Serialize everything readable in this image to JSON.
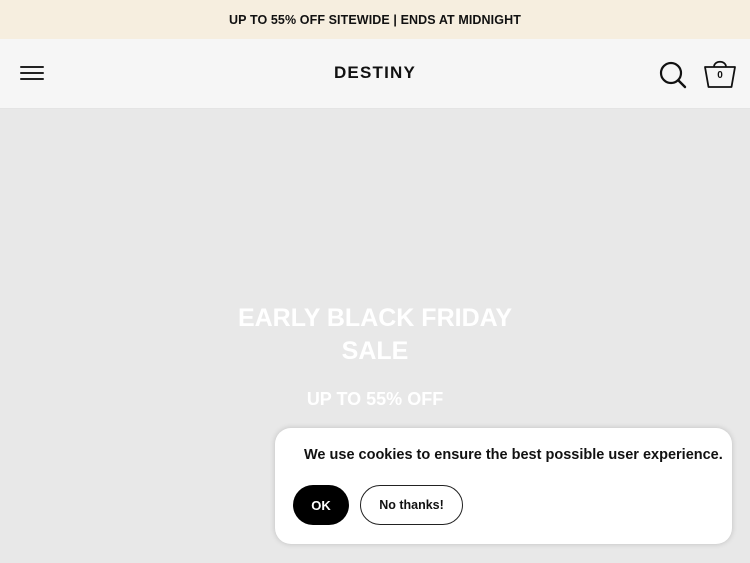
{
  "announcement": {
    "text": "UP TO 55% OFF SITEWIDE | ENDS AT MIDNIGHT"
  },
  "header": {
    "logo": "DESTINY",
    "menu_icon": "hamburger-menu-icon",
    "search_icon": "search-icon",
    "cart_icon": "basket-icon",
    "cart_count": "0"
  },
  "hero": {
    "title_line1": "EARLY BLACK FRIDAY",
    "title_line2": "SALE",
    "subtitle": "UP TO 55% OFF"
  },
  "cookie_banner": {
    "message": "We use cookies to ensure the best possible user experience.",
    "accept_label": "OK",
    "decline_label": "No thanks!"
  },
  "colors": {
    "announcement_bg": "#f6eedf",
    "header_bg": "#f6f6f6",
    "hero_bg": "#e8e8e8",
    "accent": "#000000"
  }
}
